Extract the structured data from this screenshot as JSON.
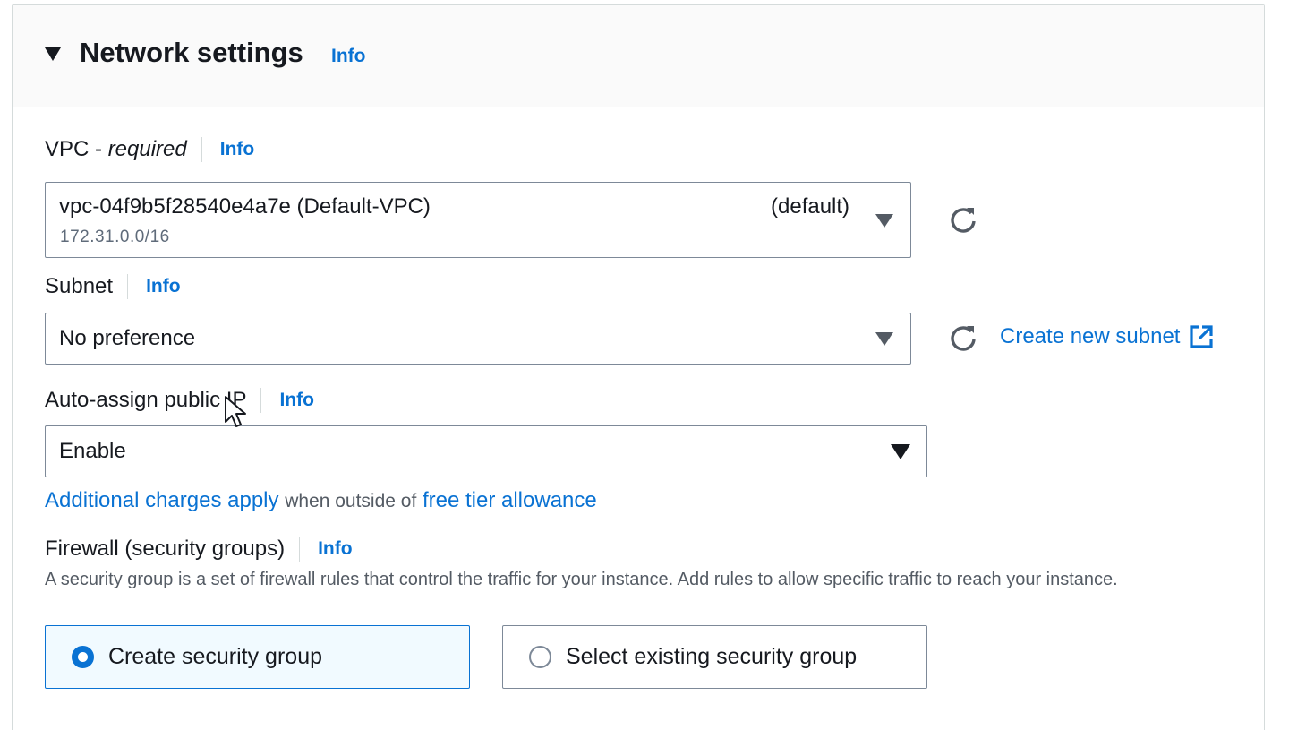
{
  "section": {
    "title": "Network settings",
    "info_label": "Info"
  },
  "vpc": {
    "label": "VPC -",
    "required": "required",
    "info_label": "Info",
    "value": "vpc-04f9b5f28540e4a7e (Default-VPC)",
    "cidr": "172.31.0.0/16",
    "default_tag": "(default)"
  },
  "subnet": {
    "label": "Subnet",
    "info_label": "Info",
    "value": "No preference",
    "create_link": "Create new subnet"
  },
  "auto_assign_ip": {
    "label": "Auto-assign public IP",
    "info_label": "Info",
    "value": "Enable",
    "charges_link": "Additional charges apply",
    "charges_text": "when outside of",
    "free_tier_link": "free tier allowance"
  },
  "firewall": {
    "label": "Firewall (security groups)",
    "info_label": "Info",
    "description": "A security group is a set of firewall rules that control the traffic for your instance. Add rules to allow specific traffic to reach your instance.",
    "options": [
      {
        "label": "Create security group",
        "selected": true
      },
      {
        "label": "Select existing security group",
        "selected": false
      }
    ]
  },
  "colors": {
    "accent": "#0972d3",
    "text": "#16191f",
    "muted": "#545b64",
    "border": "#7d8998"
  },
  "icons": [
    "caret-down-icon",
    "refresh-icon",
    "external-link-icon",
    "dropdown-triangle-icon",
    "mouse-cursor-icon"
  ]
}
